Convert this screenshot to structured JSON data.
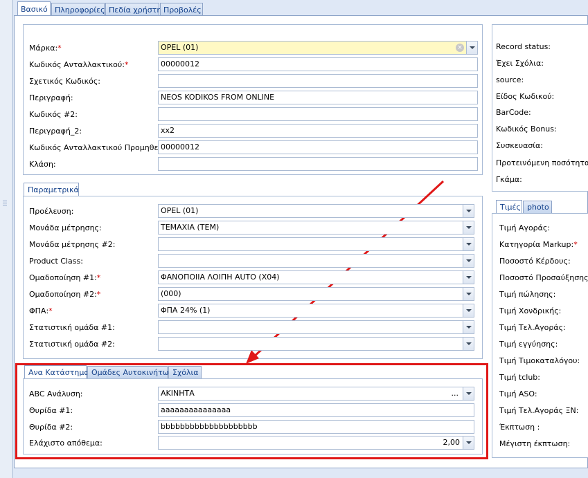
{
  "tabs": [
    "Βασικό",
    "Πληροφορίες",
    "Πεδία χρήστη",
    "Προβολές"
  ],
  "main_fields": [
    {
      "label": "Μάρκα:",
      "required": true,
      "value": "OPEL (01)"
    },
    {
      "label": "Κωδικός Ανταλλακτικού:",
      "required": true,
      "value": "00000012"
    },
    {
      "label": "Σχετικός Κωδικός:",
      "required": false,
      "value": ""
    },
    {
      "label": "Περιγραφή:",
      "required": false,
      "value": "NEOS KODIKOS FROM ONLINE"
    },
    {
      "label": "Κωδικός #2:",
      "required": false,
      "value": ""
    },
    {
      "label": "Περιγραφή_2:",
      "required": false,
      "value": "xx2"
    },
    {
      "label": "Κωδικός Ανταλλακτικού Προμηθευτή:",
      "required": false,
      "value": "00000012"
    },
    {
      "label": "Κλάση:",
      "required": false,
      "value": ""
    }
  ],
  "parametrika_tab": "Παραμετρικά",
  "param_fields": [
    {
      "label": "Προέλευση:",
      "required": false,
      "value": "OPEL (01)"
    },
    {
      "label": "Μονάδα μέτρησης:",
      "required": false,
      "value": "ΤΕΜΑΧΙΑ (ΤΕΜ)"
    },
    {
      "label": "Μονάδα μέτρησης #2:",
      "required": false,
      "value": ""
    },
    {
      "label": "Product Class:",
      "required": false,
      "value": ""
    },
    {
      "label": "Ομαδοποίηση #1:",
      "required": true,
      "value": "ΦΑΝΟΠΟΙΙΑ ΛΟΙΠΗ AUTO (X04)"
    },
    {
      "label": "Ομαδοποίηση #2:",
      "required": true,
      "value": " (000)"
    },
    {
      "label": "ΦΠΑ:",
      "required": true,
      "value": "ΦΠΑ 24%  (1)"
    },
    {
      "label": "Στατιστική ομάδα #1:",
      "required": false,
      "value": ""
    },
    {
      "label": "Στατιστική ομάδα #2:",
      "required": false,
      "value": ""
    }
  ],
  "store_tabs": [
    "Ανα Κατάστημα",
    "Ομάδες Αυτοκινήτων",
    "Σχόλια"
  ],
  "store_fields": {
    "abc_label": "ABC Ανάλυση:",
    "abc_value": "ΑΚΙΝΗΤΑ",
    "abc_ellipsis": "...",
    "shelf1_label": "Θυρίδα #1:",
    "shelf1_value": "aaaaaaaaaaaaaaa",
    "shelf2_label": "Θυρίδα #2:",
    "shelf2_value": "bbbbbbbbbbbbbbbbbbbb",
    "minstock_label": "Ελάχιστο απόθεμα:",
    "minstock_value": "2,00"
  },
  "info_labels": [
    "Record status:",
    "Έχει Σχόλια:",
    "source:",
    "Είδος Κωδικού:",
    "BarCode:",
    "Κωδικός Bonus:",
    "Συσκευασία:",
    "Προτεινόμενη ποσότητα:",
    "Γκάμα:"
  ],
  "price_tabs": [
    "Τιμές",
    "photo"
  ],
  "price_labels": [
    {
      "label": "Τιμή Αγοράς:",
      "required": false
    },
    {
      "label": "Κατηγορία Markup:",
      "required": true
    },
    {
      "label": "Ποσοστό Κέρδους:",
      "required": false
    },
    {
      "label": "Ποσοστό Προσαύξησης:",
      "required": false
    },
    {
      "label": "Τιμή πώλησης:",
      "required": false
    },
    {
      "label": "Τιμή Χονδρικής:",
      "required": false
    },
    {
      "label": "Τιμή Τελ.Αγοράς:",
      "required": false
    },
    {
      "label": "Τιμή εγγύησης:",
      "required": false
    },
    {
      "label": "Τιμή Τιμοκαταλόγου:",
      "required": false
    },
    {
      "label": "Τιμή tclub:",
      "required": false
    },
    {
      "label": "Τιμή ASO:",
      "required": false
    },
    {
      "label": "Τιμή Τελ.Αγοράς ΞΝ:",
      "required": false
    },
    {
      "label": "Έκπτωση :",
      "required": false
    },
    {
      "label": "Μέγιστη έκπτωση:",
      "required": false
    }
  ],
  "required_mark": "*",
  "colors": {
    "annotation": "#e01818",
    "tab_text": "#15428b",
    "highlight_field": "#fff9c4"
  }
}
